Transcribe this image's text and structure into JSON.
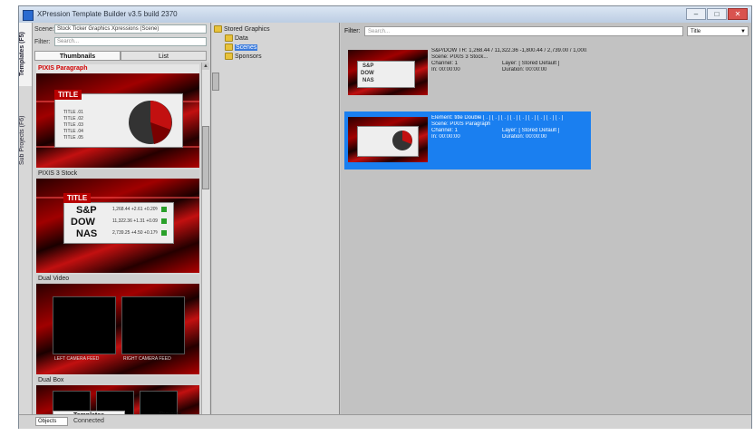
{
  "window": {
    "title": "XPression Template Builder v3.5 build 2370",
    "min": "–",
    "max": "□",
    "close": "✕"
  },
  "sidetabs": [
    "Templates (F5)",
    "Sub Projects (F6)"
  ],
  "leftpanel": {
    "scene_label": "Scene:",
    "scene_value": "Stock Ticker Graphics Xpressions (Scene)",
    "filter_label": "Filter:",
    "filter_placeholder": "Search...",
    "tabs": [
      "Thumbnails",
      "List"
    ],
    "thumbnails": [
      {
        "label": "PIXIS Paragraph",
        "selected": true,
        "title": "TITLE",
        "rows": [
          "TITLE .01",
          "TITLE .02",
          "TITLE .03",
          "TITLE .04",
          "TITLE .05"
        ]
      },
      {
        "label": "PIXIS 3 Stock",
        "selected": false,
        "title": "TITLE",
        "tickers": [
          "S&P",
          "DOW",
          "NAS"
        ],
        "values": [
          "1,268.44  +2.61  +0.20%",
          "11,322.36  +1.31  +0.09%",
          "2,739.25  +4.50  +0.17%"
        ]
      },
      {
        "label": "Dual Video",
        "selected": false,
        "captions": [
          "LEFT CAMERA FEED",
          "RIGHT CAMERA FEED"
        ]
      },
      {
        "label": "Dual Box",
        "selected": false
      }
    ],
    "bottom_tabs": [
      "Templates",
      "Projects"
    ]
  },
  "statusbar": {
    "dropdown": "Objects",
    "text": "Connected"
  },
  "tree": {
    "root": "Stored Graphics",
    "children": [
      "Data",
      "Scenes",
      "Sponsors"
    ],
    "selected": "Scenes"
  },
  "main": {
    "filter_label": "Filter:",
    "filter_placeholder": "Search...",
    "filter_select": "Title",
    "entries": [
      {
        "selected": false,
        "lines": [
          "S&P/DOW  TR: 1,268.44  / 11,322.36  -1,800.44 / 2,739.00 / 1,000...",
          "Scene: PIXIS 3 Stock..."
        ],
        "channel": "Channel: 1",
        "layer": "Layer: [ Stored Default ]",
        "in": "In: 00:00:00",
        "duration": "Duration: 00:00:00"
      },
      {
        "selected": true,
        "lines": [
          "Element: title   Double   [ . ] [ . ] [ . ] [ . ] [ . ] [ . ] [ . ] [ . ] [ . ]",
          "Scene: PIXIS Paragraph"
        ],
        "channel": "Channel: 1",
        "layer": "Layer: [ Stored Default ]",
        "in": "In: 00:00:00",
        "duration": "Duration: 00:00:00"
      }
    ]
  },
  "colors": {
    "accent": "#1a7ff0",
    "brand_red": "#b80000",
    "window_bg": "#c9c9c9"
  }
}
